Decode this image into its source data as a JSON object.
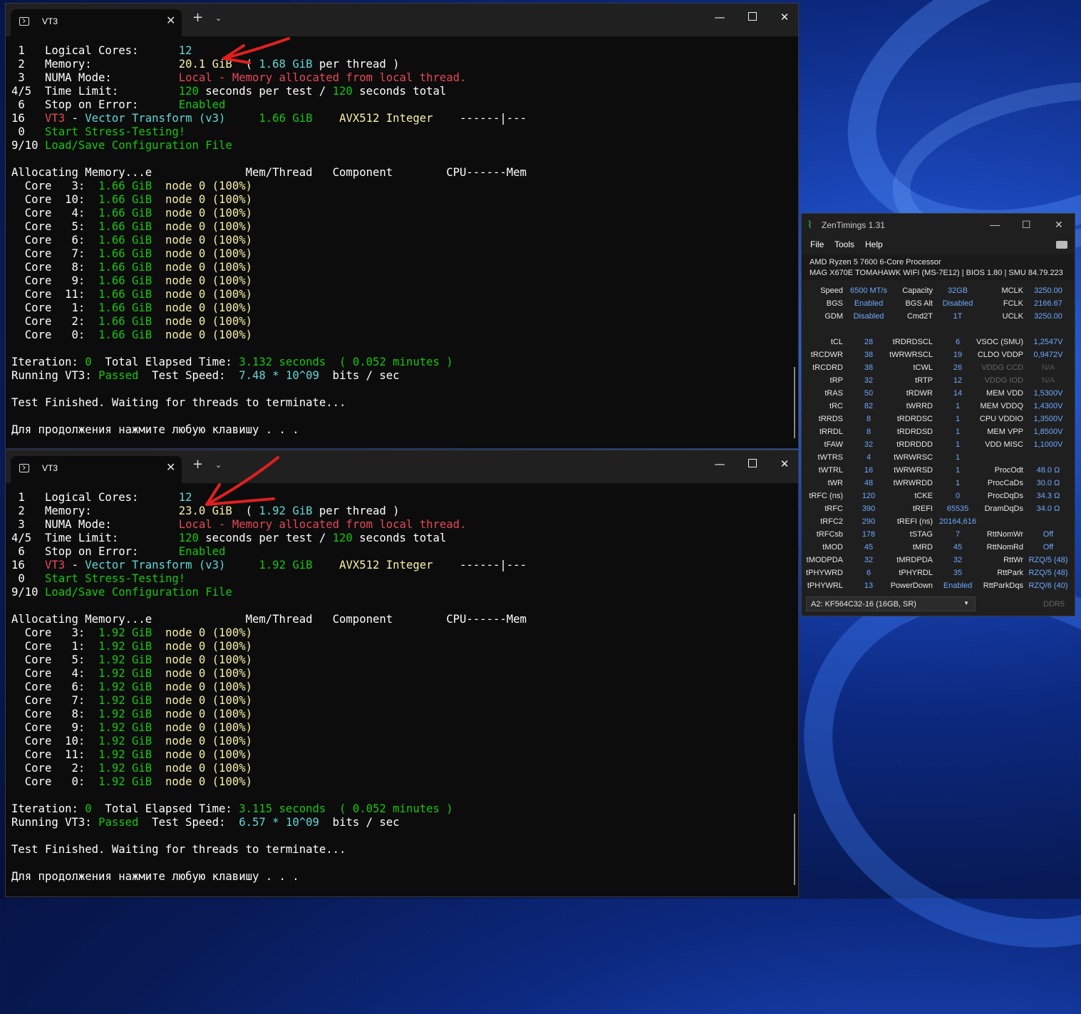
{
  "terminals": [
    {
      "tab_title": "VT3",
      "lines": [
        [
          {
            "t": " 1   Logical Cores:      ",
            "c": "w"
          },
          {
            "t": "12",
            "c": "c"
          }
        ],
        [
          {
            "t": " 2   Memory:             ",
            "c": "w"
          },
          {
            "t": "20.1 GiB",
            "c": "y"
          },
          {
            "t": "  ( ",
            "c": "w"
          },
          {
            "t": "1.68 GiB",
            "c": "c"
          },
          {
            "t": " per thread )",
            "c": "w"
          }
        ],
        [
          {
            "t": " 3   NUMA Mode:          ",
            "c": "w"
          },
          {
            "t": "Local - Memory allocated from local thread.",
            "c": "r"
          }
        ],
        [
          {
            "t": "4/5  Time Limit:         ",
            "c": "w"
          },
          {
            "t": "120",
            "c": "g"
          },
          {
            "t": " seconds per test / ",
            "c": "w"
          },
          {
            "t": "120",
            "c": "g"
          },
          {
            "t": " seconds total",
            "c": "w"
          }
        ],
        [
          {
            "t": " 6   Stop on Error:      ",
            "c": "w"
          },
          {
            "t": "Enabled",
            "c": "g"
          }
        ],
        [
          {
            "t": "16   ",
            "c": "w"
          },
          {
            "t": "VT3",
            "c": "r"
          },
          {
            "t": " - ",
            "c": "w"
          },
          {
            "t": "Vector Transform (v3)",
            "c": "c"
          },
          {
            "t": "     ",
            "c": "w"
          },
          {
            "t": "1.66 GiB",
            "c": "g"
          },
          {
            "t": "    ",
            "c": "w"
          },
          {
            "t": "AVX512 Integer",
            "c": "y"
          },
          {
            "t": "    ------|---",
            "c": "w"
          }
        ],
        [
          {
            "t": " 0   ",
            "c": "w"
          },
          {
            "t": "Start Stress-Testing!",
            "c": "g"
          }
        ],
        [
          {
            "t": "9/10 ",
            "c": "w"
          },
          {
            "t": "Load/Save Configuration File",
            "c": "g"
          }
        ],
        [],
        [
          {
            "t": "Allocating Memory...e              Mem/Thread   Component        CPU------Mem",
            "c": "w"
          }
        ],
        [
          {
            "t": "  Core   3:  ",
            "c": "w"
          },
          {
            "t": "1.66 GiB",
            "c": "g"
          },
          {
            "t": "  node 0 (100%)",
            "c": "y"
          }
        ],
        [
          {
            "t": "  Core  10:  ",
            "c": "w"
          },
          {
            "t": "1.66 GiB",
            "c": "g"
          },
          {
            "t": "  node 0 (100%)",
            "c": "y"
          }
        ],
        [
          {
            "t": "  Core   4:  ",
            "c": "w"
          },
          {
            "t": "1.66 GiB",
            "c": "g"
          },
          {
            "t": "  node 0 (100%)",
            "c": "y"
          }
        ],
        [
          {
            "t": "  Core   5:  ",
            "c": "w"
          },
          {
            "t": "1.66 GiB",
            "c": "g"
          },
          {
            "t": "  node 0 (100%)",
            "c": "y"
          }
        ],
        [
          {
            "t": "  Core   6:  ",
            "c": "w"
          },
          {
            "t": "1.66 GiB",
            "c": "g"
          },
          {
            "t": "  node 0 (100%)",
            "c": "y"
          }
        ],
        [
          {
            "t": "  Core   7:  ",
            "c": "w"
          },
          {
            "t": "1.66 GiB",
            "c": "g"
          },
          {
            "t": "  node 0 (100%)",
            "c": "y"
          }
        ],
        [
          {
            "t": "  Core   8:  ",
            "c": "w"
          },
          {
            "t": "1.66 GiB",
            "c": "g"
          },
          {
            "t": "  node 0 (100%)",
            "c": "y"
          }
        ],
        [
          {
            "t": "  Core   9:  ",
            "c": "w"
          },
          {
            "t": "1.66 GiB",
            "c": "g"
          },
          {
            "t": "  node 0 (100%)",
            "c": "y"
          }
        ],
        [
          {
            "t": "  Core  11:  ",
            "c": "w"
          },
          {
            "t": "1.66 GiB",
            "c": "g"
          },
          {
            "t": "  node 0 (100%)",
            "c": "y"
          }
        ],
        [
          {
            "t": "  Core   1:  ",
            "c": "w"
          },
          {
            "t": "1.66 GiB",
            "c": "g"
          },
          {
            "t": "  node 0 (100%)",
            "c": "y"
          }
        ],
        [
          {
            "t": "  Core   2:  ",
            "c": "w"
          },
          {
            "t": "1.66 GiB",
            "c": "g"
          },
          {
            "t": "  node 0 (100%)",
            "c": "y"
          }
        ],
        [
          {
            "t": "  Core   0:  ",
            "c": "w"
          },
          {
            "t": "1.66 GiB",
            "c": "g"
          },
          {
            "t": "  node 0 (100%)",
            "c": "y"
          }
        ],
        [],
        [
          {
            "t": "Iteration: ",
            "c": "w"
          },
          {
            "t": "0",
            "c": "g"
          },
          {
            "t": "  Total Elapsed Time: ",
            "c": "w"
          },
          {
            "t": "3.132 seconds",
            "c": "g"
          },
          {
            "t": "  ( 0.052 minutes )",
            "c": "g"
          }
        ],
        [
          {
            "t": "Running VT3: ",
            "c": "w"
          },
          {
            "t": "Passed",
            "c": "g"
          },
          {
            "t": "  Test Speed:  ",
            "c": "w"
          },
          {
            "t": "7.48 * 10^09",
            "c": "c"
          },
          {
            "t": "  bits / sec",
            "c": "w"
          }
        ],
        [],
        [
          {
            "t": "Test Finished. Waiting for threads to terminate...",
            "c": "w"
          }
        ],
        [],
        [
          {
            "t": "Для продолжения нажмите любую клавишу . . .",
            "c": "w"
          }
        ]
      ]
    },
    {
      "tab_title": "VT3",
      "lines": [
        [
          {
            "t": " 1   Logical Cores:      ",
            "c": "w"
          },
          {
            "t": "12",
            "c": "c"
          }
        ],
        [
          {
            "t": " 2   Memory:             ",
            "c": "w"
          },
          {
            "t": "23.0 GiB",
            "c": "y"
          },
          {
            "t": "  ( ",
            "c": "w"
          },
          {
            "t": "1.92 GiB",
            "c": "c"
          },
          {
            "t": " per thread )",
            "c": "w"
          }
        ],
        [
          {
            "t": " 3   NUMA Mode:          ",
            "c": "w"
          },
          {
            "t": "Local - Memory allocated from local thread.",
            "c": "r"
          }
        ],
        [
          {
            "t": "4/5  Time Limit:         ",
            "c": "w"
          },
          {
            "t": "120",
            "c": "g"
          },
          {
            "t": " seconds per test / ",
            "c": "w"
          },
          {
            "t": "120",
            "c": "g"
          },
          {
            "t": " seconds total",
            "c": "w"
          }
        ],
        [
          {
            "t": " 6   Stop on Error:      ",
            "c": "w"
          },
          {
            "t": "Enabled",
            "c": "g"
          }
        ],
        [
          {
            "t": "16   ",
            "c": "w"
          },
          {
            "t": "VT3",
            "c": "r"
          },
          {
            "t": " - ",
            "c": "w"
          },
          {
            "t": "Vector Transform (v3)",
            "c": "c"
          },
          {
            "t": "     ",
            "c": "w"
          },
          {
            "t": "1.92 GiB",
            "c": "g"
          },
          {
            "t": "    ",
            "c": "w"
          },
          {
            "t": "AVX512 Integer",
            "c": "y"
          },
          {
            "t": "    ------|---",
            "c": "w"
          }
        ],
        [
          {
            "t": " 0   ",
            "c": "w"
          },
          {
            "t": "Start Stress-Testing!",
            "c": "g"
          }
        ],
        [
          {
            "t": "9/10 ",
            "c": "w"
          },
          {
            "t": "Load/Save Configuration File",
            "c": "g"
          }
        ],
        [],
        [
          {
            "t": "Allocating Memory...e              Mem/Thread   Component        CPU------Mem",
            "c": "w"
          }
        ],
        [
          {
            "t": "  Core   3:  ",
            "c": "w"
          },
          {
            "t": "1.92 GiB",
            "c": "g"
          },
          {
            "t": "  node 0 (100%)",
            "c": "y"
          }
        ],
        [
          {
            "t": "  Core   1:  ",
            "c": "w"
          },
          {
            "t": "1.92 GiB",
            "c": "g"
          },
          {
            "t": "  node 0 (100%)",
            "c": "y"
          }
        ],
        [
          {
            "t": "  Core   5:  ",
            "c": "w"
          },
          {
            "t": "1.92 GiB",
            "c": "g"
          },
          {
            "t": "  node 0 (100%)",
            "c": "y"
          }
        ],
        [
          {
            "t": "  Core   4:  ",
            "c": "w"
          },
          {
            "t": "1.92 GiB",
            "c": "g"
          },
          {
            "t": "  node 0 (100%)",
            "c": "y"
          }
        ],
        [
          {
            "t": "  Core   6:  ",
            "c": "w"
          },
          {
            "t": "1.92 GiB",
            "c": "g"
          },
          {
            "t": "  node 0 (100%)",
            "c": "y"
          }
        ],
        [
          {
            "t": "  Core   7:  ",
            "c": "w"
          },
          {
            "t": "1.92 GiB",
            "c": "g"
          },
          {
            "t": "  node 0 (100%)",
            "c": "y"
          }
        ],
        [
          {
            "t": "  Core   8:  ",
            "c": "w"
          },
          {
            "t": "1.92 GiB",
            "c": "g"
          },
          {
            "t": "  node 0 (100%)",
            "c": "y"
          }
        ],
        [
          {
            "t": "  Core   9:  ",
            "c": "w"
          },
          {
            "t": "1.92 GiB",
            "c": "g"
          },
          {
            "t": "  node 0 (100%)",
            "c": "y"
          }
        ],
        [
          {
            "t": "  Core  10:  ",
            "c": "w"
          },
          {
            "t": "1.92 GiB",
            "c": "g"
          },
          {
            "t": "  node 0 (100%)",
            "c": "y"
          }
        ],
        [
          {
            "t": "  Core  11:  ",
            "c": "w"
          },
          {
            "t": "1.92 GiB",
            "c": "g"
          },
          {
            "t": "  node 0 (100%)",
            "c": "y"
          }
        ],
        [
          {
            "t": "  Core   2:  ",
            "c": "w"
          },
          {
            "t": "1.92 GiB",
            "c": "g"
          },
          {
            "t": "  node 0 (100%)",
            "c": "y"
          }
        ],
        [
          {
            "t": "  Core   0:  ",
            "c": "w"
          },
          {
            "t": "1.92 GiB",
            "c": "g"
          },
          {
            "t": "  node 0 (100%)",
            "c": "y"
          }
        ],
        [],
        [
          {
            "t": "Iteration: ",
            "c": "w"
          },
          {
            "t": "0",
            "c": "g"
          },
          {
            "t": "  Total Elapsed Time: ",
            "c": "w"
          },
          {
            "t": "3.115 seconds",
            "c": "g"
          },
          {
            "t": "  ( 0.052 minutes )",
            "c": "g"
          }
        ],
        [
          {
            "t": "Running VT3: ",
            "c": "w"
          },
          {
            "t": "Passed",
            "c": "g"
          },
          {
            "t": "  Test Speed:  ",
            "c": "w"
          },
          {
            "t": "6.57 * 10^09",
            "c": "c"
          },
          {
            "t": "  bits / sec",
            "c": "w"
          }
        ],
        [],
        [
          {
            "t": "Test Finished. Waiting for threads to terminate...",
            "c": "w"
          }
        ],
        [],
        [
          {
            "t": "Для продолжения нажмите любую клавишу . . .",
            "c": "w"
          }
        ]
      ]
    }
  ],
  "zen": {
    "title": "ZenTimings 1.31",
    "menu": [
      "File",
      "Tools",
      "Help"
    ],
    "cpu": "AMD Ryzen 5 7600 6-Core Processor",
    "board": "MAG X670E TOMAHAWK WIFI (MS-7E12) | BIOS 1.80 | SMU 84.79.223",
    "rows": [
      [
        [
          "Speed",
          "6500 MT/s"
        ],
        [
          "Capacity",
          "32GB"
        ],
        [
          "MCLK",
          "3250.00"
        ]
      ],
      [
        [
          "BGS",
          "Enabled"
        ],
        [
          "BGS Alt",
          "Disabled"
        ],
        [
          "FCLK",
          "2166.67"
        ]
      ],
      [
        [
          "GDM",
          "Disabled"
        ],
        [
          "Cmd2T",
          "1T"
        ],
        [
          "UCLK",
          "3250.00"
        ]
      ],
      [],
      [
        [
          "tCL",
          "28"
        ],
        [
          "tRDRDSCL",
          "6"
        ],
        [
          "VSOC (SMU)",
          "1,2547V"
        ]
      ],
      [
        [
          "tRCDWR",
          "38"
        ],
        [
          "tWRWRSCL",
          "19"
        ],
        [
          "CLDO VDDP",
          "0,9472V"
        ]
      ],
      [
        [
          "tRCDRD",
          "38"
        ],
        [
          "tCWL",
          "26"
        ],
        [
          "VDDG CCD",
          "N/A"
        ]
      ],
      [
        [
          "tRP",
          "32"
        ],
        [
          "tRTP",
          "12"
        ],
        [
          "VDDG IOD",
          "N/A"
        ]
      ],
      [
        [
          "tRAS",
          "50"
        ],
        [
          "tRDWR",
          "14"
        ],
        [
          "MEM VDD",
          "1,5300V"
        ]
      ],
      [
        [
          "tRC",
          "82"
        ],
        [
          "tWRRD",
          "1"
        ],
        [
          "MEM VDDQ",
          "1,4300V"
        ]
      ],
      [
        [
          "tRRDS",
          "8"
        ],
        [
          "tRDRDSC",
          "1"
        ],
        [
          "CPU VDDIO",
          "1,3500V"
        ]
      ],
      [
        [
          "tRRDL",
          "8"
        ],
        [
          "tRDRDSD",
          "1"
        ],
        [
          "MEM VPP",
          "1,8500V"
        ]
      ],
      [
        [
          "tFAW",
          "32"
        ],
        [
          "tRDRDDD",
          "1"
        ],
        [
          "VDD MISC",
          "1,1000V"
        ]
      ],
      [
        [
          "tWTRS",
          "4"
        ],
        [
          "tWRWRSC",
          "1"
        ],
        [
          "",
          ""
        ]
      ],
      [
        [
          "tWTRL",
          "16"
        ],
        [
          "tWRWRSD",
          "1"
        ],
        [
          "ProcOdt",
          "48.0 Ω"
        ]
      ],
      [
        [
          "tWR",
          "48"
        ],
        [
          "tWRWRDD",
          "1"
        ],
        [
          "ProcCaDs",
          "30.0 Ω"
        ]
      ],
      [
        [
          "tRFC (ns)",
          "120"
        ],
        [
          "tCKE",
          "0"
        ],
        [
          "ProcDqDs",
          "34.3 Ω"
        ]
      ],
      [
        [
          "tRFC",
          "390"
        ],
        [
          "tREFI",
          "65535"
        ],
        [
          "DramDqDs",
          "34.0 Ω"
        ]
      ],
      [
        [
          "tRFC2",
          "290"
        ],
        [
          "tREFI (ns)",
          "20164,616"
        ],
        [
          "",
          ""
        ]
      ],
      [
        [
          "tRFCsb",
          "178"
        ],
        [
          "tSTAG",
          "7"
        ],
        [
          "RttNomWr",
          "Off"
        ]
      ],
      [
        [
          "tMOD",
          "45"
        ],
        [
          "tMRD",
          "45"
        ],
        [
          "RttNomRd",
          "Off"
        ]
      ],
      [
        [
          "tMODPDA",
          "32"
        ],
        [
          "tMRDPDA",
          "32"
        ],
        [
          "RttWr",
          "RZQ/5 (48)"
        ]
      ],
      [
        [
          "tPHYWRD",
          "6"
        ],
        [
          "tPHYRDL",
          "35"
        ],
        [
          "RttPark",
          "RZQ/5 (48)"
        ]
      ],
      [
        [
          "tPHYWRL",
          "13"
        ],
        [
          "PowerDown",
          "Enabled"
        ],
        [
          "RttParkDqs",
          "RZQ/6 (40)"
        ]
      ]
    ],
    "module": "A2: KF564C32-16 (16GB, SR)",
    "ddr": "DDR5"
  }
}
